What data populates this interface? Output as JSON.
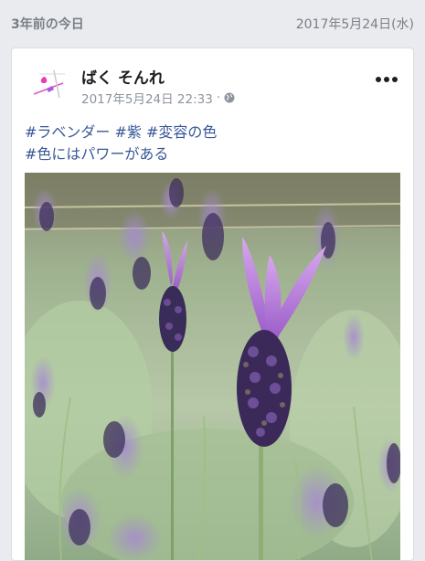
{
  "memory": {
    "years_ago_label": "3年前の今日",
    "date_label": "2017年5月24日(水)"
  },
  "post": {
    "author": "ばく そんれ",
    "timestamp": "2017年5月24日 22:33",
    "separator": "·",
    "privacy_icon": "globe-icon",
    "more_icon": "more-options-icon",
    "text_lines": [
      "#ラベンダー #紫 #変容の色",
      "#色にはパワーがある"
    ],
    "photo_subject": "lavender-photo"
  },
  "colors": {
    "background": "#e9ebee",
    "hashtag": "#385898",
    "meta_text": "#8d949e",
    "author_text": "#1c1e21"
  }
}
